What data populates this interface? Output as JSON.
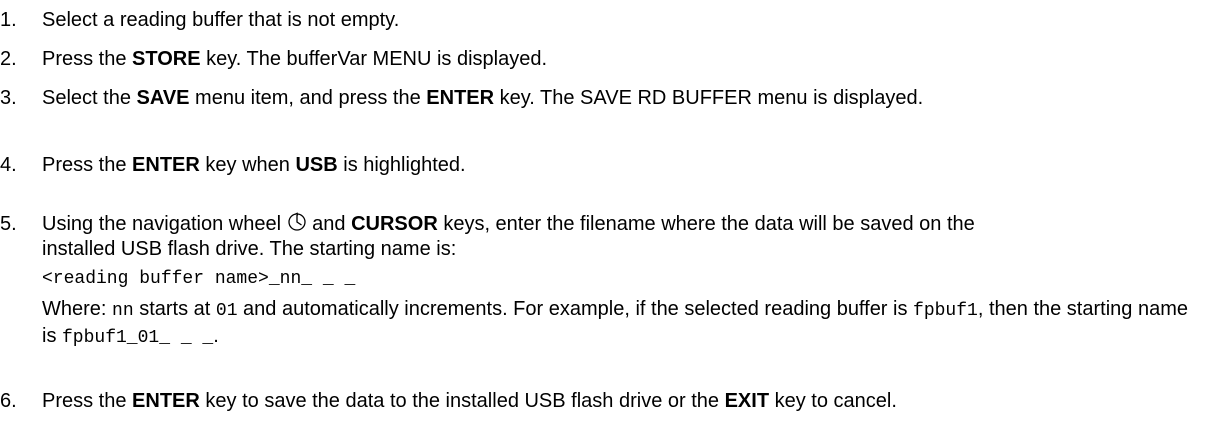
{
  "steps": [
    {
      "num": "1.",
      "text": "Select a reading buffer that is not empty."
    },
    {
      "num": "2.",
      "t1": "Press the ",
      "b1": "STORE",
      "t2": " key. The bufferVar MENU is displayed."
    },
    {
      "num": "3.",
      "t1": "Select the ",
      "b1": "SAVE",
      "t2": " menu item, and press the ",
      "b2": "ENTER",
      "t3": " key. The SAVE RD BUFFER menu is displayed."
    },
    {
      "num": "4.",
      "t1": "Press the ",
      "b1": "ENTER",
      "t2": " key when ",
      "b2": "USB",
      "t3": " is highlighted."
    },
    {
      "num": "5.",
      "t1": "Using the navigation wheel ",
      "icon": "navigation-wheel-icon",
      "t2": " and ",
      "b1": "CURSOR",
      "t3": " keys, enter the filename where the data will be saved on the installed USB flash drive. The starting name is:",
      "code_line": "<reading buffer name>_nn_ _ _",
      "w1": "Where: ",
      "c1": "nn",
      "w2": " starts at ",
      "c2": "01",
      "w3": " and automatically increments. For example, if the selected reading buffer is ",
      "c3": "fpbuf1",
      "w4": ", then the starting name is ",
      "c4": "fpbuf1_01_ _ _",
      "w5": "."
    },
    {
      "num": "6.",
      "t1": "Press the ",
      "b1": "ENTER",
      "t2": " key to save the data to the installed USB flash drive or the ",
      "b2": "EXIT",
      "t3": " key to cancel."
    }
  ]
}
